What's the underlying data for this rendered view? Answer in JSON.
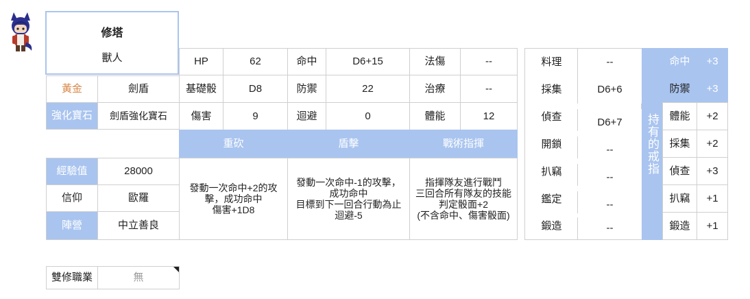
{
  "character": {
    "name": "修塔",
    "race": "獸人"
  },
  "left_info": {
    "rank_label": "黃金",
    "rank_value": "劍盾",
    "gem_label": "強化寶石",
    "gem_value": "劍盾強化寶石",
    "exp_label": "經驗值",
    "exp_value": "28000",
    "faith_label": "信仰",
    "faith_value": "歐羅",
    "camp_label": "陣營",
    "camp_value": "中立善良"
  },
  "stats": {
    "hp_label": "HP",
    "hp_value": "62",
    "hit_label": "命中",
    "hit_value": "D6+15",
    "magic_label": "法傷",
    "magic_value": "--",
    "base_dice_label": "基礎骰",
    "base_dice_value": "D8",
    "defense_label": "防禦",
    "defense_value": "22",
    "heal_label": "治療",
    "heal_value": "--",
    "damage_label": "傷害",
    "damage_value": "9",
    "evade_label": "迴避",
    "evade_value": "0",
    "stamina_label": "體能",
    "stamina_value": "12"
  },
  "skills": [
    {
      "name": "重砍",
      "desc": "發動一次命中+2的攻擊，成功命中\n傷害+1D8"
    },
    {
      "name": "盾擊",
      "desc": "發動一次命中-1的攻擊，\n成功命中\n目標到下一回合行動為止\n迴避-5"
    },
    {
      "name": "戰術指揮",
      "desc": "指揮隊友進行戰鬥\n三回合所有隊友的技能判定骰面+2\n(不含命中、傷害骰面)"
    }
  ],
  "life_skills": [
    {
      "label": "料理",
      "value": "--"
    },
    {
      "label": "採集",
      "value": "D6+6"
    },
    {
      "label": "偵查",
      "value": "D6+7"
    },
    {
      "label": "開鎖",
      "value": "--"
    },
    {
      "label": "扒竊",
      "value": "--"
    },
    {
      "label": "鑑定",
      "value": "--"
    },
    {
      "label": "鍛造",
      "value": "--"
    }
  ],
  "rings": {
    "title": "持有的戒指",
    "items": [
      {
        "label": "命中",
        "value": "+3"
      },
      {
        "label": "防禦",
        "value": "+3"
      },
      {
        "label": "體能",
        "value": "+2"
      },
      {
        "label": "採集",
        "value": "+2"
      },
      {
        "label": "偵查",
        "value": "+3"
      },
      {
        "label": "扒竊",
        "value": "+1"
      },
      {
        "label": "鍛造",
        "value": "+1"
      }
    ]
  },
  "dual_class": {
    "label": "雙修職業",
    "value": "無"
  },
  "colors": {
    "header_blue": "#a9c4ef",
    "gold_text": "#d8894a",
    "highlight_border": "#a9c4ef"
  }
}
